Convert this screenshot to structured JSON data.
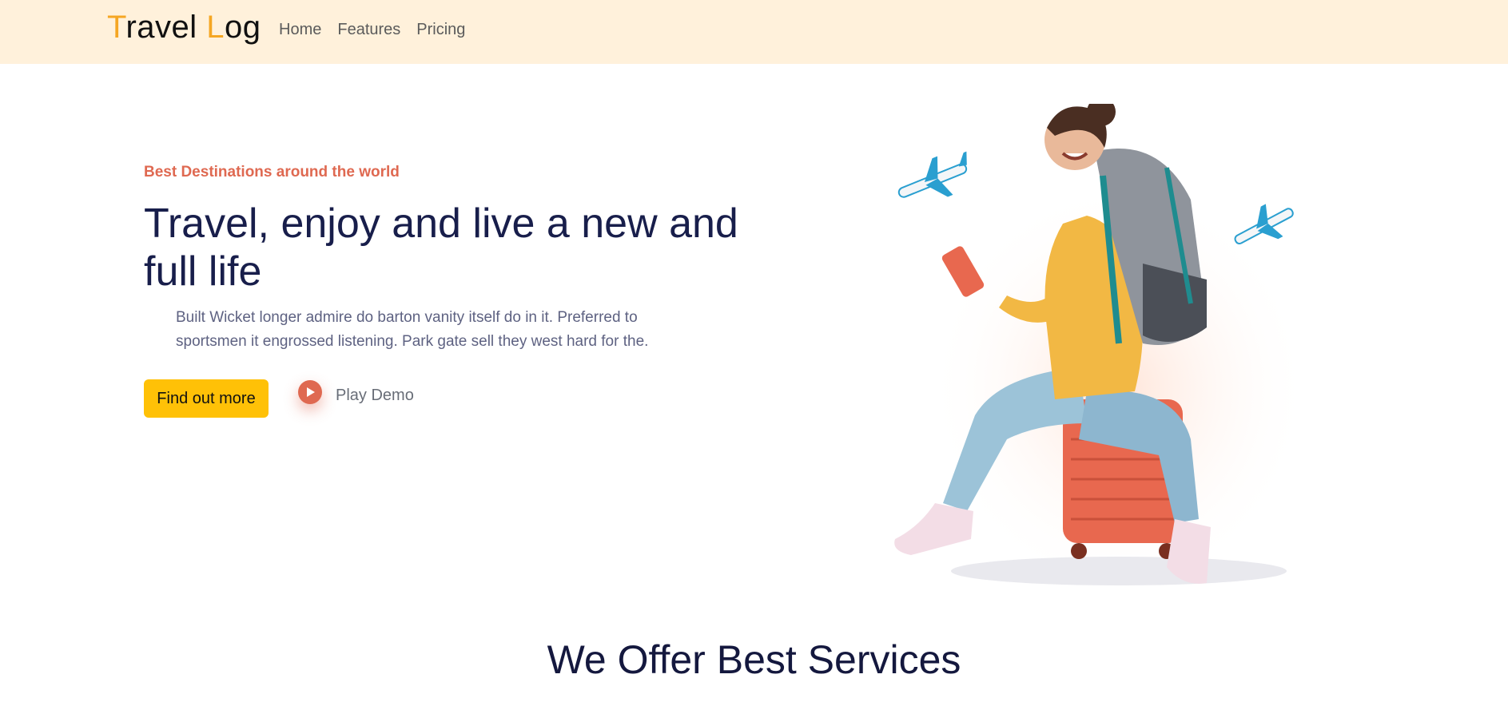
{
  "brand": {
    "first_letter": "T",
    "part1": "ravel ",
    "second_letter": "L",
    "part2": "og"
  },
  "nav": {
    "items": [
      "Home",
      "Features",
      "Pricing"
    ]
  },
  "hero": {
    "tagline": "Best Destinations around the world",
    "headline": "Travel, enjoy and live a new and full life",
    "description": "Built Wicket longer admire do barton vanity itself do in it. Preferred to sportsmen it engrossed listening. Park gate sell they west hard for the.",
    "cta_label": "Find out more",
    "play_label": "Play Demo"
  },
  "services": {
    "title": "We Offer Best Services"
  },
  "icons": {
    "play": "play-icon",
    "plane": "airplane-icon"
  },
  "colors": {
    "accent": "#ffc107",
    "brand_accent": "#f5a623",
    "tagline": "#df6951",
    "heading": "#181e4b",
    "navbar_bg": "#fff1db"
  }
}
